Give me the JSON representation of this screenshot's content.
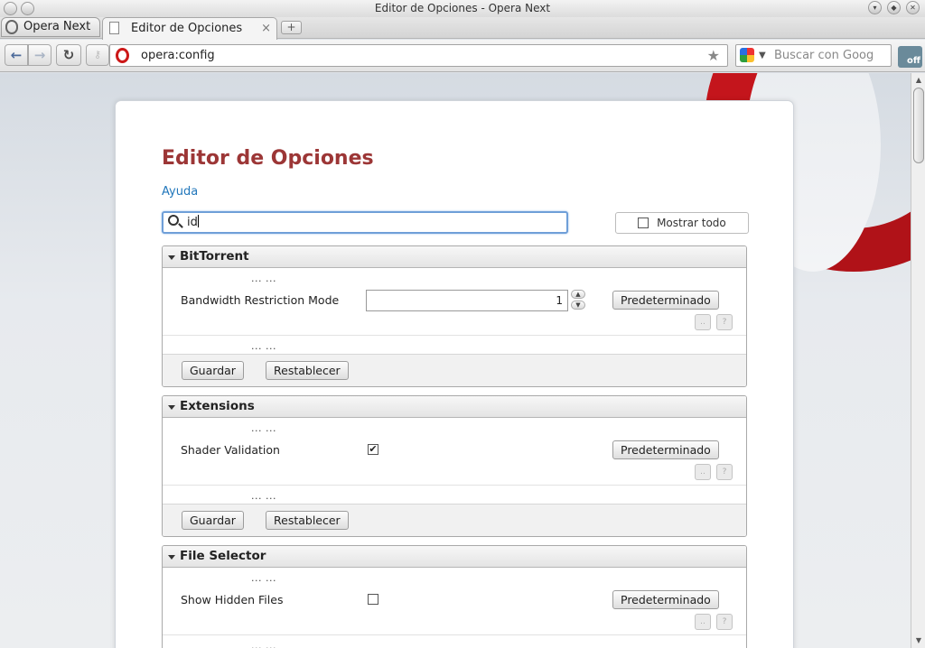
{
  "window": {
    "title": "Editor de Opciones - Opera Next"
  },
  "tabs": {
    "menu_label": "Opera Next",
    "active_tab_label": "Editor de Opciones",
    "close_glyph": "×",
    "new_tab_glyph": "+"
  },
  "toolbar": {
    "url": "opera:config",
    "search_placeholder": "Buscar con Goog",
    "turbo_label": "off",
    "back_glyph": "←",
    "forward_glyph": "→",
    "reload_glyph": "↻",
    "star_glyph": "★"
  },
  "page": {
    "title": "Editor de Opciones",
    "help_link": "Ayuda",
    "search_value": "id",
    "show_all_label": "Mostrar todo",
    "show_all_checked": false
  },
  "sections": [
    {
      "name": "BitTorrent",
      "ellipsis": "... ...",
      "pref_label": "Bandwidth Restriction Mode",
      "pref_type": "number",
      "pref_value": "1",
      "default_label": "Predeterminado",
      "mini_a": "..",
      "mini_b": "?",
      "save_label": "Guardar",
      "reset_label": "Restablecer"
    },
    {
      "name": "Extensions",
      "ellipsis": "... ...",
      "pref_label": "Shader Validation",
      "pref_type": "checkbox",
      "pref_checked": true,
      "check_glyph": "✔",
      "default_label": "Predeterminado",
      "mini_a": "..",
      "mini_b": "?",
      "save_label": "Guardar",
      "reset_label": "Restablecer"
    },
    {
      "name": "File Selector",
      "ellipsis": "... ...",
      "pref_label": "Show Hidden Files",
      "pref_type": "checkbox",
      "pref_checked": false,
      "default_label": "Predeterminado",
      "mini_a": "..",
      "mini_b": "?"
    }
  ]
}
